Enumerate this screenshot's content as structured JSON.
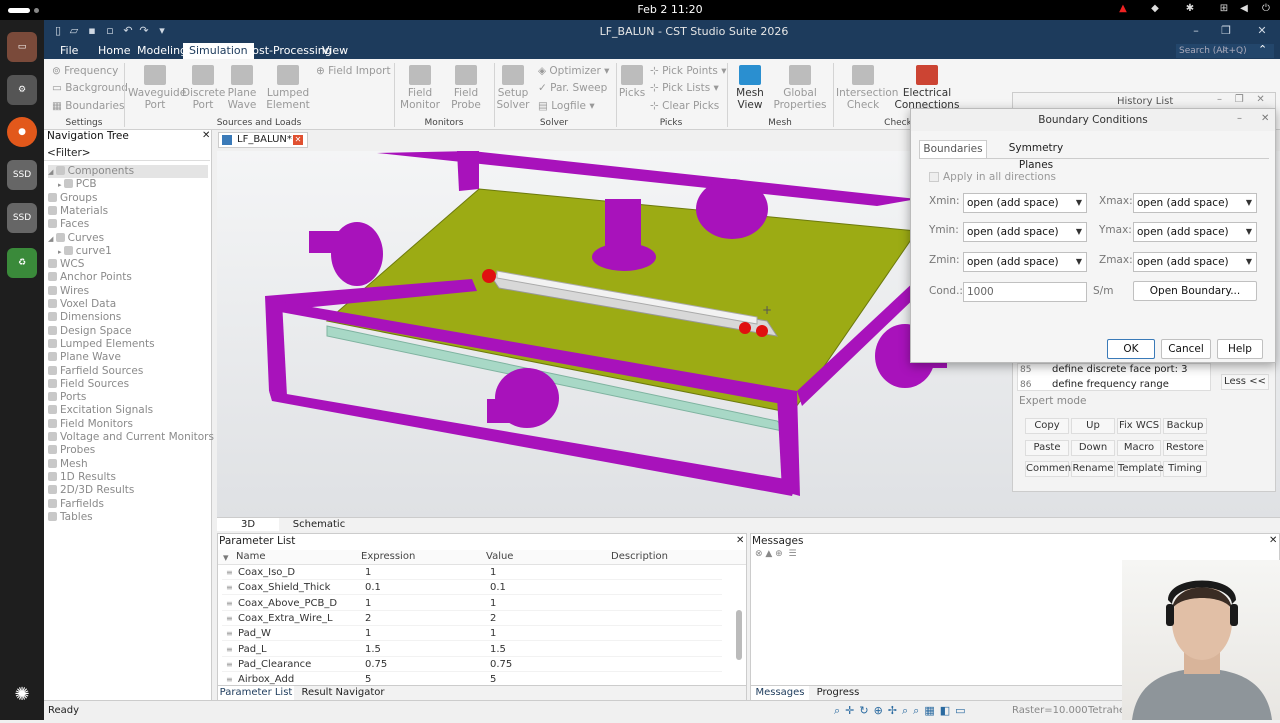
{
  "topbar": {
    "clock": "Feb 2  11:20"
  },
  "dock": {
    "ssd1": "SSD",
    "ssd2": "SSD"
  },
  "window": {
    "title": "LF_BALUN - CST Studio Suite 2026",
    "search_placeholder": "Search (Alt+Q)"
  },
  "menu": {
    "file": "File",
    "home": "Home",
    "modeling": "Modeling",
    "simulation": "Simulation",
    "post": "Post-Processing",
    "view": "View"
  },
  "ribbon": {
    "settings": {
      "frequency": "Frequency",
      "background": "Background",
      "boundaries": "Boundaries",
      "label": "Settings"
    },
    "sources": {
      "waveguide": "Waveguide\nPort",
      "discrete": "Discrete\nPort",
      "plane_wave": "Plane\nWave",
      "lumped": "Lumped\nElement",
      "field_import": "Field Import",
      "label": "Sources and Loads"
    },
    "monitors": {
      "field_monitor": "Field\nMonitor",
      "field_probe": "Field\nProbe",
      "label": "Monitors"
    },
    "solver": {
      "setup": "Setup\nSolver",
      "optimizer": "Optimizer",
      "par_sweep": "Par. Sweep",
      "logfile": "Logfile",
      "label": "Solver"
    },
    "picks": {
      "picks": "Picks",
      "pick_points": "Pick Points",
      "pick_lists": "Pick Lists",
      "clear_picks": "Clear Picks",
      "label": "Picks"
    },
    "mesh": {
      "mesh_view": "Mesh\nView",
      "global_props": "Global\nProperties",
      "label": "Mesh"
    },
    "check": {
      "intersection": "Intersection\nCheck",
      "electrical": "Electrical\nConnections",
      "label": "Check"
    }
  },
  "nav": {
    "title": "Navigation Tree",
    "filter": "<Filter>",
    "items": [
      "Components",
      "PCB",
      "Groups",
      "Materials",
      "Faces",
      "Curves",
      "curve1",
      "WCS",
      "Anchor Points",
      "Wires",
      "Voxel Data",
      "Dimensions",
      "Design Space",
      "Lumped Elements",
      "Plane Wave",
      "Farfield Sources",
      "Field Sources",
      "Ports",
      "Excitation Signals",
      "Field Monitors",
      "Voltage and Current Monitors",
      "Probes",
      "Mesh",
      "1D Results",
      "2D/3D Results",
      "Farfields",
      "Tables"
    ]
  },
  "doc_tab": "LF_BALUN*",
  "view_tabs": {
    "t3d": "3D",
    "schematic": "Schematic"
  },
  "params": {
    "title": "Parameter List",
    "headers": {
      "name": "Name",
      "expression": "Expression",
      "value": "Value",
      "description": "Description"
    },
    "rows": [
      {
        "name": "Coax_Iso_D",
        "expr": "1",
        "value": "1"
      },
      {
        "name": "Coax_Shield_Thick",
        "expr": "0.1",
        "value": "0.1"
      },
      {
        "name": "Coax_Above_PCB_D",
        "expr": "1",
        "value": "1"
      },
      {
        "name": "Coax_Extra_Wire_L",
        "expr": "2",
        "value": "2"
      },
      {
        "name": "Pad_W",
        "expr": "1",
        "value": "1"
      },
      {
        "name": "Pad_L",
        "expr": "1.5",
        "value": "1.5"
      },
      {
        "name": "Pad_Clearance",
        "expr": "0.75",
        "value": "0.75"
      },
      {
        "name": "Airbox_Add",
        "expr": "5",
        "value": "5"
      }
    ],
    "tab_param": "Parameter List",
    "tab_result": "Result Navigator"
  },
  "messages": {
    "title": "Messages",
    "tab_messages": "Messages",
    "tab_progress": "Progress"
  },
  "status": {
    "ready": "Ready",
    "raster": "Raster=10.000",
    "tetra": "Tetrahe"
  },
  "history": {
    "title": "History List",
    "line85": "define discrete face port: 3",
    "line86": "define frequency range",
    "num85": "85",
    "num86": "86",
    "less": "Less <<",
    "expert": "Expert mode",
    "buttons": [
      "Copy",
      "Up",
      "Fix WCS",
      "Backup",
      "Paste",
      "Down",
      "Macro",
      "Restore",
      "Comment",
      "Rename",
      "Template",
      "Timing"
    ]
  },
  "dialog": {
    "title": "Boundary Conditions",
    "tab_boundaries": "Boundaries",
    "tab_symmetry": "Symmetry Planes",
    "apply_all": "Apply in all directions",
    "xmin_label": "Xmin:",
    "xmax_label": "Xmax:",
    "ymin_label": "Ymin:",
    "ymax_label": "Ymax:",
    "zmin_label": "Zmin:",
    "zmax_label": "Zmax:",
    "xmin": "open (add space)",
    "xmax": "open (add space)",
    "ymin": "open (add space)",
    "ymax": "open (add space)",
    "zmin": "open (add space)",
    "zmax": "open (add space)",
    "cond_label": "Cond.:",
    "cond_value": "1000",
    "cond_unit": "S/m",
    "open_boundary": "Open Boundary...",
    "ok": "OK",
    "cancel": "Cancel",
    "help": "Help"
  },
  "colors": {
    "titlebar": "#1d3b5c",
    "airbox": "#9b0fb3",
    "pcb": "#9aa81a",
    "substrate": "#a5d3c4",
    "port": "#e01010"
  }
}
